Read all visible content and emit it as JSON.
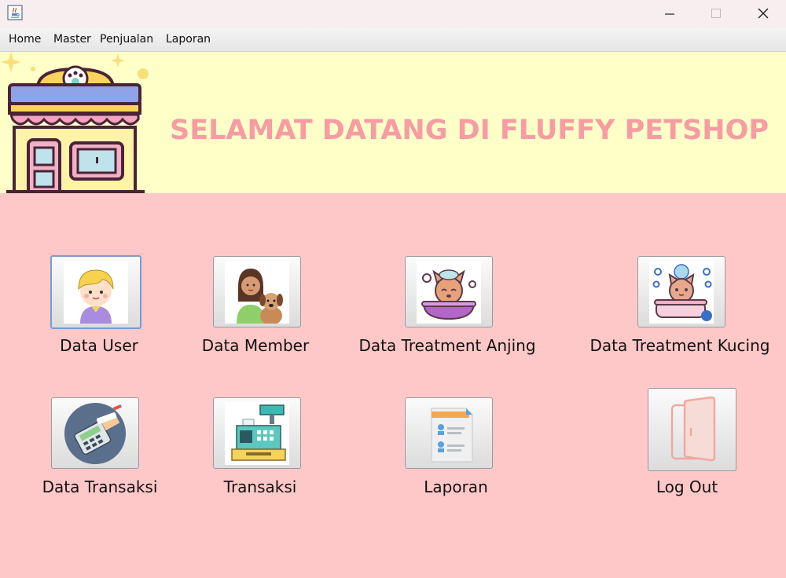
{
  "window": {
    "icon": "java-cup-icon",
    "controls": {
      "minimize": "—",
      "maximize": "☐",
      "close": "✕"
    }
  },
  "menu": {
    "items": [
      {
        "label": "Home"
      },
      {
        "label": "Master"
      },
      {
        "label": "Penjualan"
      },
      {
        "label": "Laporan"
      }
    ]
  },
  "banner": {
    "title": "SELAMAT DATANG DI FLUFFY PETSHOP",
    "colors": {
      "background": "#ffffc8",
      "title": "#f79ca3"
    }
  },
  "dashboard": {
    "background": "#fec8c8",
    "buttons": [
      {
        "label": "Data User",
        "icon": "user-avatar-icon"
      },
      {
        "label": "Data Member",
        "icon": "member-with-dog-icon"
      },
      {
        "label": "Data Treatment Anjing",
        "icon": "dog-bath-icon"
      },
      {
        "label": "Data Treatment Kucing",
        "icon": "cat-bath-icon"
      },
      {
        "label": "Data Transaksi",
        "icon": "card-payment-icon"
      },
      {
        "label": "Transaksi",
        "icon": "cash-register-icon"
      },
      {
        "label": "Laporan",
        "icon": "report-document-icon"
      },
      {
        "label": "Log Out",
        "icon": "door-exit-icon"
      }
    ]
  }
}
